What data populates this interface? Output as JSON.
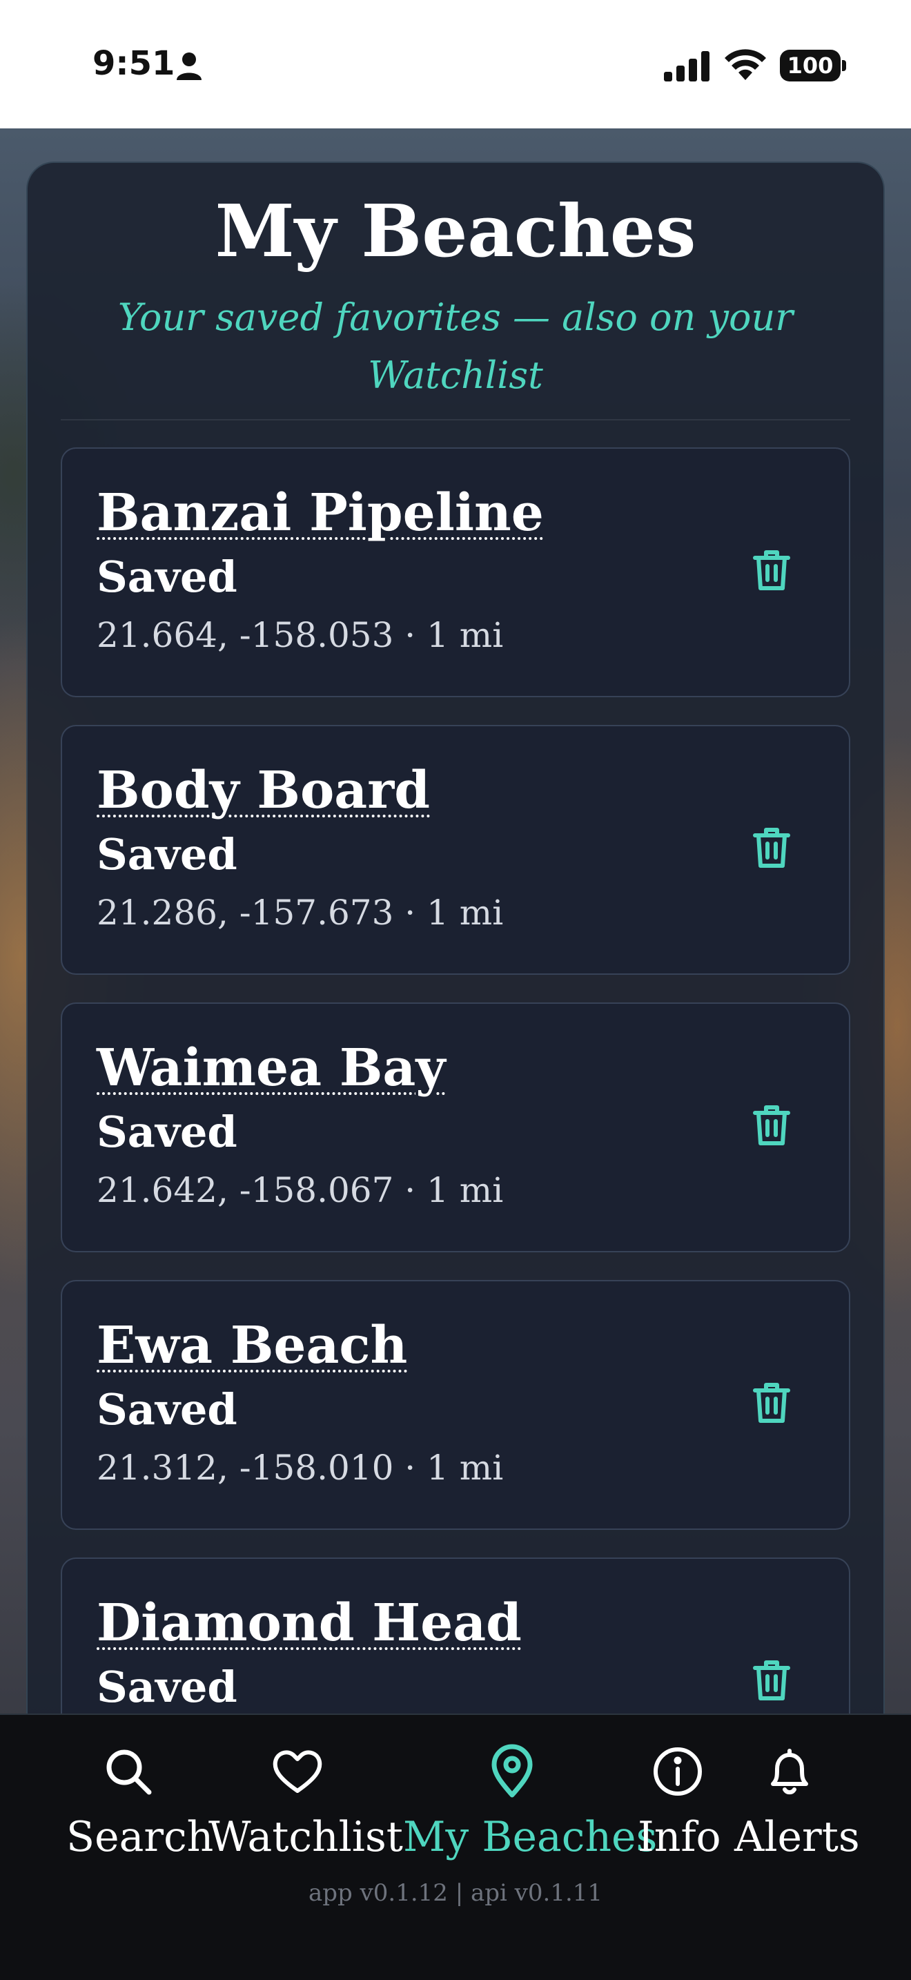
{
  "status_bar": {
    "time": "9:51",
    "battery": "100",
    "icons": [
      "person-icon",
      "cellular-signal-icon",
      "wifi-icon",
      "battery-icon"
    ]
  },
  "header": {
    "title": "My Beaches",
    "subtitle": "Your saved favorites — also on your Watchlist"
  },
  "beaches": [
    {
      "name": "Banzai Pipeline",
      "status": "Saved",
      "meta": "21.664, -158.053 · 1 mi"
    },
    {
      "name": "Body Board",
      "status": "Saved",
      "meta": "21.286, -157.673 · 1 mi"
    },
    {
      "name": "Waimea Bay",
      "status": "Saved",
      "meta": "21.642, -158.067 · 1 mi"
    },
    {
      "name": "Ewa Beach",
      "status": "Saved",
      "meta": "21.312, -158.010 · 1 mi"
    },
    {
      "name": "Diamond Head",
      "status": "Saved"
    }
  ],
  "card_action_icon": "trash-icon",
  "nav": {
    "items": [
      {
        "label": "Search",
        "icon": "search-icon"
      },
      {
        "label": "Watchlist",
        "icon": "heart-icon"
      },
      {
        "label": "My Beaches",
        "icon": "map-pin-icon",
        "active": true
      },
      {
        "label": "Info",
        "icon": "info-icon"
      },
      {
        "label": "Alerts",
        "icon": "bell-icon"
      }
    ],
    "version": "app v0.1.12 | api v0.1.11"
  },
  "colors": {
    "accent": "#4fd6bf",
    "panel": "#1c2230",
    "card": "#1b2131",
    "nav_background": "#0e0f12"
  }
}
